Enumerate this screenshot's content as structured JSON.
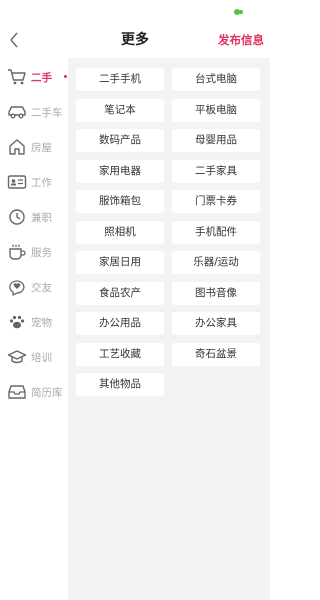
{
  "colors": {
    "accent": "#e2335f",
    "status_green": "#55c23a",
    "sidebar_text": "#aaaaaa",
    "icon_gray": "#666666",
    "content_bg": "#f3f3f3"
  },
  "header": {
    "title": "更多",
    "publish_label": "发布信息",
    "back_icon": "chevron-left"
  },
  "sidebar": {
    "items": [
      {
        "label": "二手",
        "icon": "cart-icon",
        "active": true
      },
      {
        "label": "二手车",
        "icon": "car-icon",
        "active": false
      },
      {
        "label": "房屋",
        "icon": "house-icon",
        "active": false
      },
      {
        "label": "工作",
        "icon": "id-card-icon",
        "active": false
      },
      {
        "label": "兼职",
        "icon": "clock-icon",
        "active": false
      },
      {
        "label": "服务",
        "icon": "cup-icon",
        "active": false
      },
      {
        "label": "交友",
        "icon": "heart-chat-icon",
        "active": false
      },
      {
        "label": "宠物",
        "icon": "paw-icon",
        "active": false
      },
      {
        "label": "培训",
        "icon": "graduation-cap-icon",
        "active": false
      },
      {
        "label": "简历库",
        "icon": "inbox-icon",
        "active": false
      }
    ]
  },
  "categories": [
    "二手手机",
    "台式电脑",
    "笔记本",
    "平板电脑",
    "数码产品",
    "母婴用品",
    "家用电器",
    "二手家具",
    "服饰箱包",
    "门票卡券",
    "照相机",
    "手机配件",
    "家居日用",
    "乐器/运动",
    "食品农产",
    "图书音像",
    "办公用品",
    "办公家具",
    "工艺收藏",
    "奇石盆景",
    "其他物品"
  ]
}
